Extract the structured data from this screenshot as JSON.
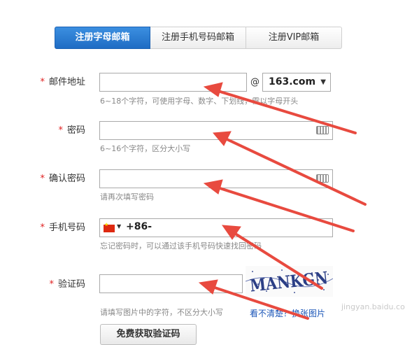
{
  "tabs": [
    {
      "label": "注册字母邮箱",
      "active": true
    },
    {
      "label": "注册手机号码邮箱",
      "active": false
    },
    {
      "label": "注册VIP邮箱",
      "active": false
    }
  ],
  "required_mark": "*",
  "fields": {
    "email": {
      "label": "邮件地址",
      "value": "",
      "at": "@",
      "domain": "163.com",
      "hint": "6~18个字符，可使用字母、数字、下划线，需以字母开头"
    },
    "password": {
      "label": "密码",
      "value": "",
      "hint": "6~16个字符，区分大小写"
    },
    "confirm": {
      "label": "确认密码",
      "value": "",
      "hint": "请再次填写密码"
    },
    "phone": {
      "label": "手机号码",
      "prefix": "+86-",
      "value": "",
      "hint": "忘记密码时，可以通过该手机号码快速找回密码"
    },
    "captcha": {
      "label": "验证码",
      "value": "",
      "hint": "请填写图片中的字符，不区分大小写",
      "refresh_link": "看不清楚？换张图片",
      "image_text": "MANKGN"
    }
  },
  "sms_button": "免费获取验证码",
  "watermark": "jingyan.baidu.com",
  "colors": {
    "tab_active": "#2a7ad6",
    "required": "#e02020",
    "arrow": "#e84a3f",
    "link": "#1a55b8"
  }
}
